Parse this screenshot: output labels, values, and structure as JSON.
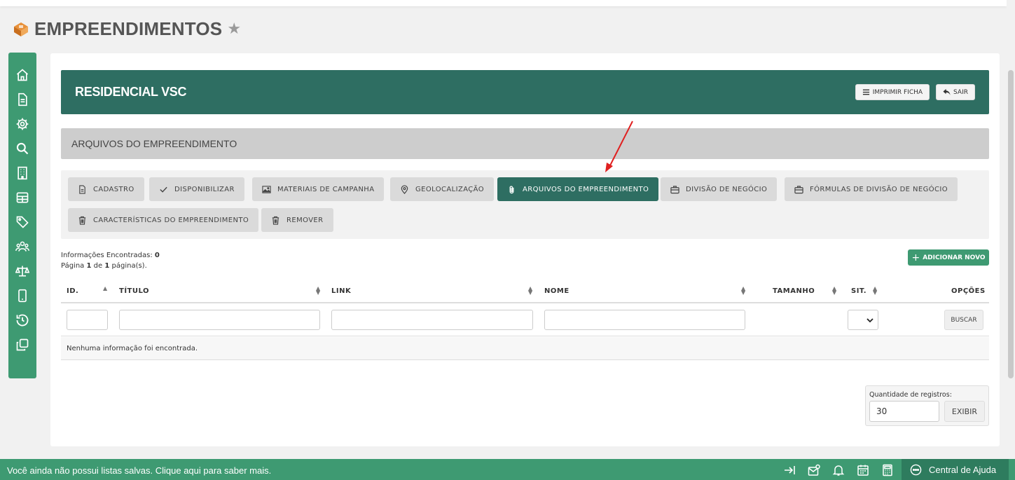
{
  "page": {
    "title": "EMPREENDIMENTOS"
  },
  "banner": {
    "title": "RESIDENCIAL VSC",
    "print_label": "IMPRIMIR FICHA",
    "exit_label": "SAIR"
  },
  "section": {
    "title": "ARQUIVOS DO EMPREENDIMENTO"
  },
  "tabs": [
    {
      "label": "CADASTRO",
      "icon": "document-icon",
      "active": false
    },
    {
      "label": "DISPONIBILIZAR",
      "icon": "check-icon",
      "active": false
    },
    {
      "label": "MATERIAIS DE CAMPANHA",
      "icon": "image-icon",
      "active": false
    },
    {
      "label": "GEOLOCALIZAÇÃO",
      "icon": "map-pin-icon",
      "active": false
    },
    {
      "label": "ARQUIVOS DO EMPREENDIMENTO",
      "icon": "paperclip-icon",
      "active": true
    },
    {
      "label": "DIVISÃO DE NEGÓCIO",
      "icon": "briefcase-icon",
      "active": false
    },
    {
      "label": "FÓRMULAS DE DIVISÃO DE NEGÓCIO",
      "icon": "briefcase-icon",
      "active": false
    },
    {
      "label": "CARACTERÍSTICAS DO EMPREENDIMENTO",
      "icon": "trash-icon",
      "active": false
    },
    {
      "label": "REMOVER",
      "icon": "trash-icon",
      "active": false
    }
  ],
  "info": {
    "found_label": "Informações Encontradas:",
    "found_count": "0",
    "page_label": "Página",
    "page_current": "1",
    "page_of": "de",
    "page_total": "1",
    "page_suffix": "página(s)."
  },
  "add_button": {
    "label": "ADICIONAR NOVO"
  },
  "table": {
    "columns": [
      "ID.",
      "TÍTULO",
      "LINK",
      "NOME",
      "TAMANHO",
      "SIT.",
      "OPÇÕES"
    ],
    "search_label": "BUSCAR",
    "empty_message": "Nenhuma informação foi encontrada."
  },
  "pagination": {
    "qty_label": "Quantidade de registros:",
    "qty_value": "30",
    "show_label": "EXIBIR"
  },
  "footer": {
    "message": "Você ainda não possui listas salvas. Clique aqui para saber mais.",
    "help_label": "Central de Ajuda"
  },
  "colors": {
    "primary_dark": "#2e6e62",
    "primary": "#3e9a72",
    "annotation_arrow": "#e02020"
  }
}
